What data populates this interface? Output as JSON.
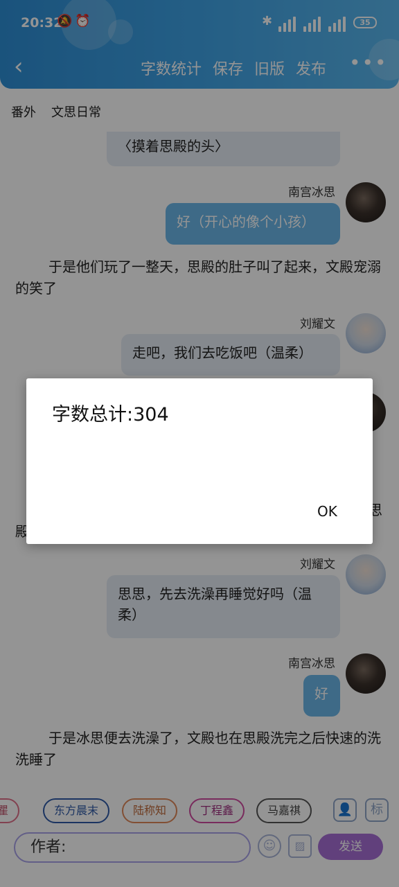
{
  "status_bar": {
    "time": "20:32",
    "battery": "35"
  },
  "header": {
    "actions": [
      "字数统计",
      "保存",
      "旧版",
      "发布"
    ],
    "more": "•••"
  },
  "subtitle": {
    "tag": "番外",
    "title": "文思日常"
  },
  "chat": {
    "msg1": "〈摸着思殿的头〉",
    "msg2_sender": "南宫冰思",
    "msg2": "好（开心的像个小孩）",
    "narr1": "于是他们玩了一整天，思殿的肚子叫了起来，文殿宠溺的笑了",
    "msg3_sender": "刘耀文",
    "msg3": "走吧，我们去吃饭吧（温柔）",
    "narr2_tail_top": "思",
    "narr2_tail_bottom": "殿",
    "msg4_sender": "刘耀文",
    "msg4": "思思，先去洗澡再睡觉好吗（温柔）",
    "msg5_sender": "南宫冰思",
    "msg5": "好",
    "narr3": "于是冰思便去洗澡了，文殿也在思殿洗完之后快速的洗洗睡了"
  },
  "composer": {
    "chips": [
      "瞿",
      "东方晨末",
      "陆称知",
      "丁程鑫",
      "马嘉祺"
    ],
    "chip_colors": [
      "#e0708a",
      "#2f5aa8",
      "#e0885a",
      "#d04aa0",
      "#555555"
    ],
    "author_placeholder": "作者:",
    "send_label": "发送",
    "tool_label": "标"
  },
  "dialog": {
    "message": "字数总计:304",
    "ok_label": "OK"
  }
}
